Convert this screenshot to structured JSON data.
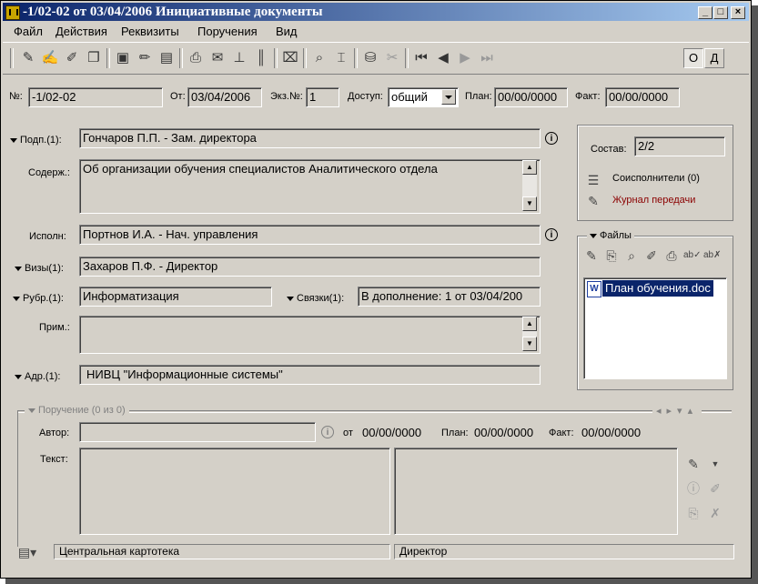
{
  "window": {
    "title": "-1/02-02 от 03/04/2006 Инициативные документы"
  },
  "menu": [
    "Файл",
    "Действия",
    "Реквизиты",
    "Поручения",
    "Вид"
  ],
  "toolbar": {
    "right_o": "О",
    "right_d": "Д"
  },
  "header": {
    "num_label": "№:",
    "num_value": "-1/02-02",
    "from_label": "От:",
    "from_value": "03/04/2006",
    "copy_label": "Экз.№:",
    "copy_value": "1",
    "access_label": "Доступ:",
    "access_value": "общий",
    "plan_label": "План:",
    "plan_value": "00/00/0000",
    "fact_label": "Факт:",
    "fact_value": "00/00/0000"
  },
  "form": {
    "podp_label": "Подп.(1):",
    "podp_value": "Гончаров П.П. - Зам. директора",
    "content_label": "Содерж.:",
    "content_value": "Об организации обучения специалистов Аналитического отдела",
    "ispoln_label": "Исполн:",
    "ispoln_value": "Портнов И.А. - Нач. управления",
    "vizy_label": "Визы(1):",
    "vizy_value": "Захаров П.Ф. - Директор",
    "rubr_label": "Рубр.(1):",
    "rubr_value": "Информатизация",
    "svyazi_label": "Связки(1):",
    "svyazi_value": "В дополнение: 1 от 03/04/200",
    "prim_label": "Прим.:",
    "prim_value": "",
    "adr_label": "Адр.(1):",
    "adr_value": "НИВЦ \"Информационные системы\""
  },
  "side": {
    "sostav_label": "Состав:",
    "sostav_value": "2/2",
    "coexec": "Соисполнители (0)",
    "journal": "Журнал передачи",
    "files_label": "Файлы",
    "files": [
      "План обучения.doc"
    ]
  },
  "assignment": {
    "section_label": "Поручение (0 из 0)",
    "author_label": "Автор:",
    "author_value": "",
    "from_label": "от",
    "from_value": "00/00/0000",
    "plan_label": "План:",
    "plan_value": "00/00/0000",
    "fact_label": "Факт:",
    "fact_value": "00/00/0000",
    "text_label": "Текст:"
  },
  "statusbar": {
    "cabinet": "Центральная картотека",
    "role": "Директор"
  },
  "colors": {
    "accent": "#0a246a",
    "link_red": "#8b0000",
    "selection": "#0a246a",
    "face": "#d4d0c8"
  }
}
